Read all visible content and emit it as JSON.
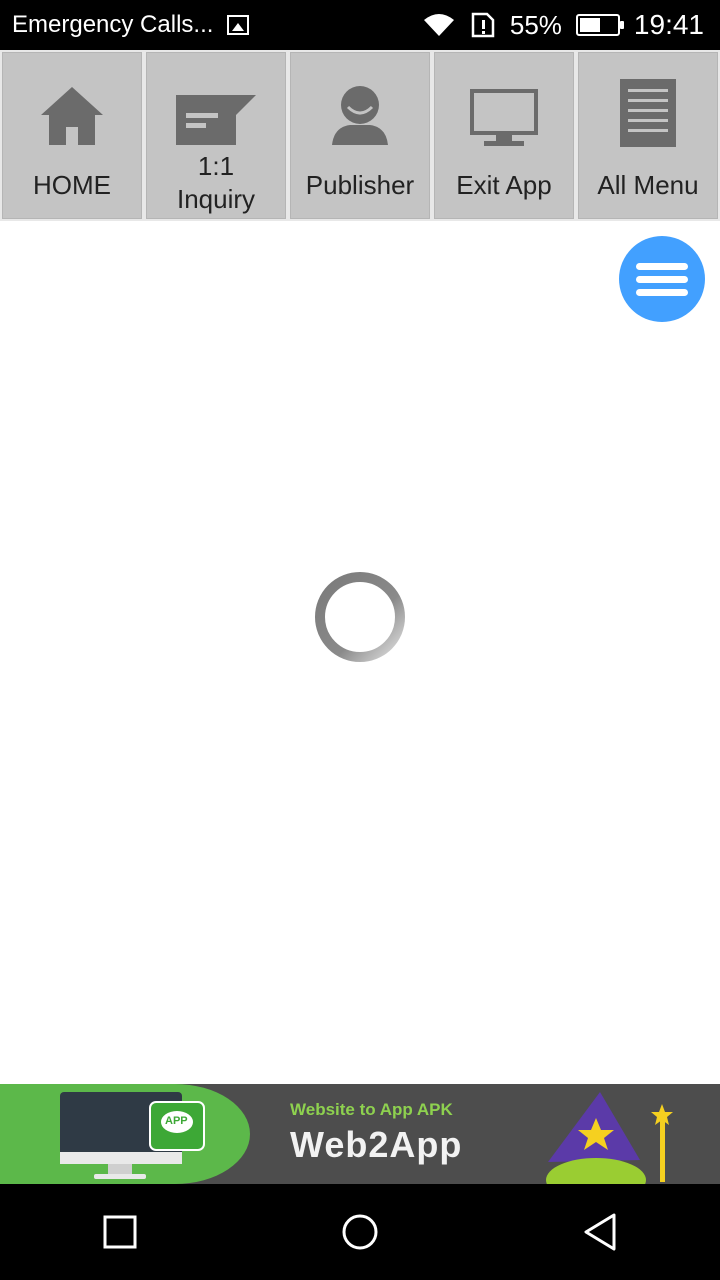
{
  "status_bar": {
    "notification_title": "Emergency Calls...",
    "battery_percent": "55%",
    "battery_level": 0.55,
    "time": "19:41",
    "icons": [
      "image-icon",
      "wifi-icon",
      "sim-alert-icon",
      "battery-icon"
    ]
  },
  "nav": {
    "items": [
      {
        "label": "HOME",
        "icon": "home-icon"
      },
      {
        "label": "1:1\nInquiry",
        "icon": "message-icon"
      },
      {
        "label": "Publisher",
        "icon": "user-icon"
      },
      {
        "label": "Exit App",
        "icon": "monitor-icon"
      },
      {
        "label": "All Menu",
        "icon": "list-icon"
      }
    ]
  },
  "fab": {
    "icon": "hamburger-menu-icon"
  },
  "loading": {
    "icon": "loading-spinner-icon"
  },
  "banner": {
    "subtitle": "Website to App APK",
    "brand": "Web2App",
    "app_badge": "APP"
  },
  "system_nav": {
    "buttons": [
      "recent-apps-button",
      "home-button",
      "back-button"
    ]
  },
  "colors": {
    "fab": "#42a0ff",
    "nav_bg": "#c4c4c4",
    "icon_gray": "#6b6b6b",
    "banner_green": "#5cb84a",
    "banner_dark": "#4d4d4d"
  }
}
